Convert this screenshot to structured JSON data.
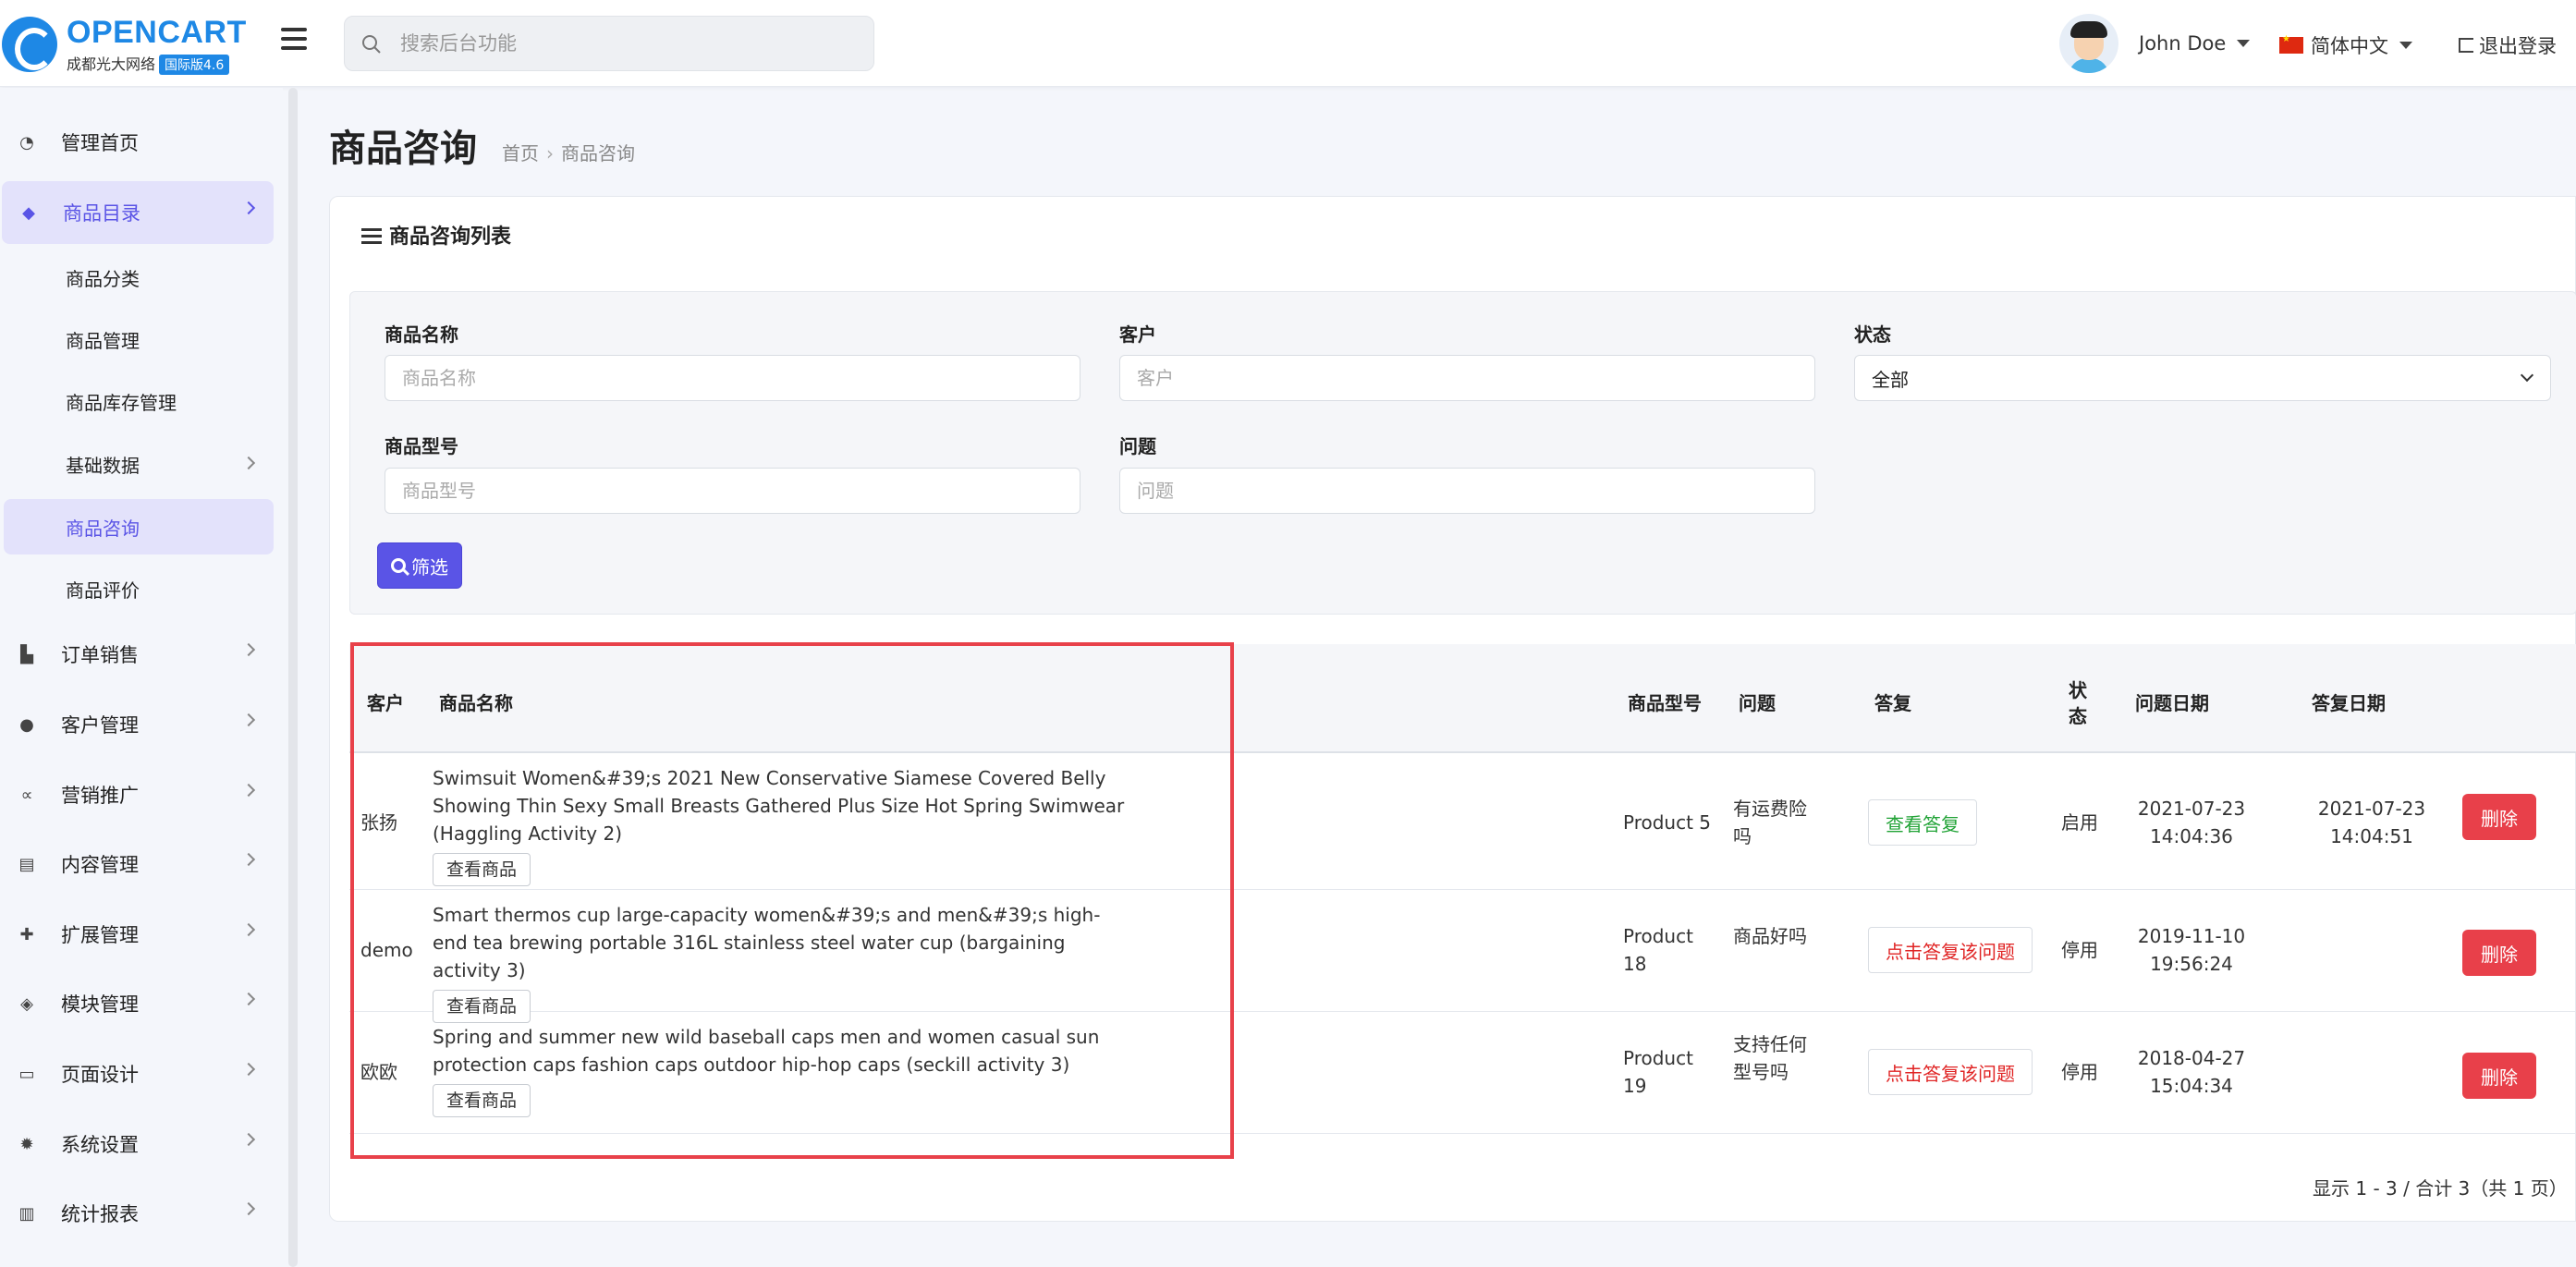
{
  "brand": {
    "name": "OPENCART",
    "subtitle": "成都光大网络",
    "badge": "国际版4.6"
  },
  "search": {
    "placeholder": "搜索后台功能"
  },
  "user": {
    "name": "John Doe"
  },
  "language": {
    "label": "简体中文"
  },
  "logout": {
    "label": "退出登录"
  },
  "sidebar": {
    "items": [
      {
        "label": "管理首页",
        "icon": "dashboard-icon"
      },
      {
        "label": "商品目录",
        "icon": "tags-icon",
        "active": true
      },
      {
        "label": "订单销售",
        "icon": "cart-icon"
      },
      {
        "label": "客户管理",
        "icon": "user-icon"
      },
      {
        "label": "营销推广",
        "icon": "share-icon"
      },
      {
        "label": "内容管理",
        "icon": "book-icon"
      },
      {
        "label": "扩展管理",
        "icon": "puzzle-icon"
      },
      {
        "label": "模块管理",
        "icon": "cube-icon"
      },
      {
        "label": "页面设计",
        "icon": "desktop-icon"
      },
      {
        "label": "系统设置",
        "icon": "cog-icon"
      },
      {
        "label": "统计报表",
        "icon": "bar-chart-icon"
      }
    ],
    "subitems": [
      {
        "label": "商品分类"
      },
      {
        "label": "商品管理"
      },
      {
        "label": "商品库存管理"
      },
      {
        "label": "基础数据"
      },
      {
        "label": "商品咨询",
        "active": true
      },
      {
        "label": "商品评价"
      }
    ]
  },
  "page": {
    "title": "商品咨询",
    "breadcrumb": [
      "首页",
      "商品咨询"
    ],
    "card_title": "商品咨询列表"
  },
  "filter": {
    "product_name_label": "商品名称",
    "product_name_placeholder": "商品名称",
    "customer_label": "客户",
    "customer_placeholder": "客户",
    "status_label": "状态",
    "status_value": "全部",
    "model_label": "商品型号",
    "model_placeholder": "商品型号",
    "question_label": "问题",
    "question_placeholder": "问题",
    "button_label": "筛选"
  },
  "table": {
    "headers": {
      "customer": "客户",
      "product": "商品名称",
      "model": "商品型号",
      "question": "问题",
      "reply": "答复",
      "status": "状态",
      "question_date": "问题日期",
      "reply_date": "答复日期"
    },
    "view_label": "查看商品",
    "delete_label": "删除",
    "rows": [
      {
        "customer": "张扬",
        "product": "Swimsuit Women&#39;s 2021 New Conservative Siamese Covered Belly Showing Thin Sexy Small Breasts Gathered Plus Size Hot Spring Swimwear (Haggling Activity 2)",
        "model": "Product 5",
        "question": "有运费险吗",
        "reply": "查看答复",
        "status": "启用",
        "question_date": "2021-07-23 14:04:36",
        "reply_date": "2021-07-23 14:04:51"
      },
      {
        "customer": "demo",
        "product": "Smart thermos cup large-capacity women&#39;s and men&#39;s high-end tea brewing portable 316L stainless steel water cup (bargaining activity 3)",
        "model": "Product 18",
        "question": "商品好吗",
        "reply": "点击答复该问题",
        "status": "停用",
        "question_date": "2019-11-10 19:56:24",
        "reply_date": ""
      },
      {
        "customer": "欧欧",
        "product": "Spring and summer new wild baseball caps men and women casual sun protection caps fashion caps outdoor hip-hop caps (seckill activity 3)",
        "model": "Product 19",
        "question": "支持任何型号吗",
        "reply": "点击答复该问题",
        "status": "停用",
        "question_date": "2018-04-27 15:04:34",
        "reply_date": ""
      }
    ]
  },
  "pager": {
    "text": "显示 1 - 3 / 合计 3（共 1 页）"
  },
  "colors": {
    "accent": "#5a54e6",
    "danger": "#e8404a",
    "success": "#21a336",
    "highlight": "#e8414a"
  }
}
